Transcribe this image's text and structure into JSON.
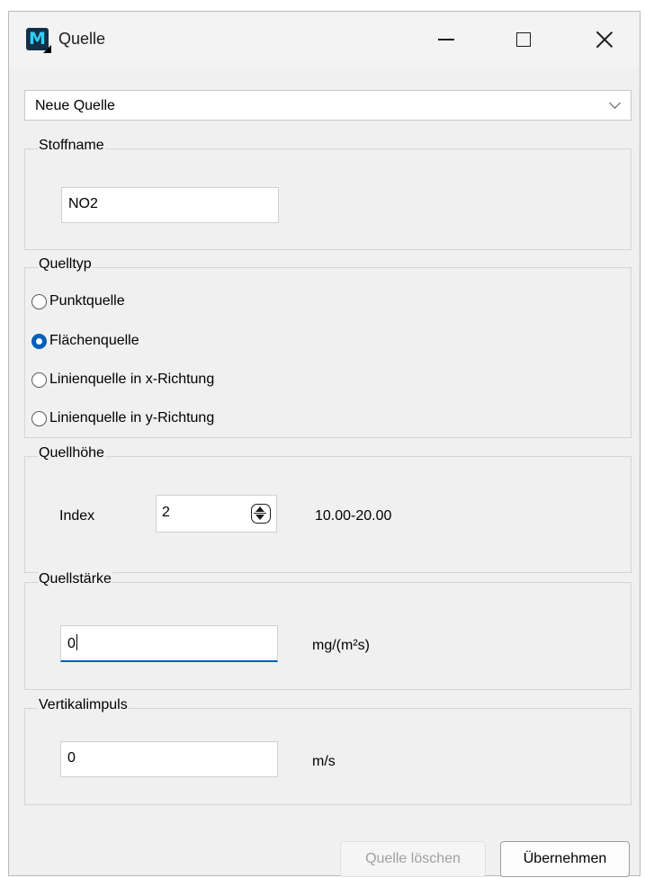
{
  "window": {
    "title": "Quelle",
    "icon": "app-logo-icon"
  },
  "source_select": {
    "selected": "Neue Quelle"
  },
  "substance": {
    "legend": "Stoffname",
    "value": "NO2"
  },
  "source_type": {
    "legend": "Quelltyp",
    "options": [
      {
        "label": "Punktquelle",
        "checked": false
      },
      {
        "label": "Flächenquelle",
        "checked": true
      },
      {
        "label": "Linienquelle in x-Richtung",
        "checked": false
      },
      {
        "label": "Linienquelle in y-Richtung",
        "checked": false
      }
    ]
  },
  "source_height": {
    "legend": "Quellhöhe",
    "index_label": "Index",
    "index_value": "2",
    "range_text": "10.00-20.00"
  },
  "source_strength": {
    "legend": "Quellstärke",
    "value": "0",
    "unit": "mg/(m²s)"
  },
  "vertical_impulse": {
    "legend": "Vertikalimpuls",
    "value": "0",
    "unit": "m/s"
  },
  "buttons": {
    "delete": "Quelle löschen",
    "apply": "Übernehmen"
  },
  "colors": {
    "accent": "#005fb8",
    "window_bg": "#f0f0f0"
  }
}
